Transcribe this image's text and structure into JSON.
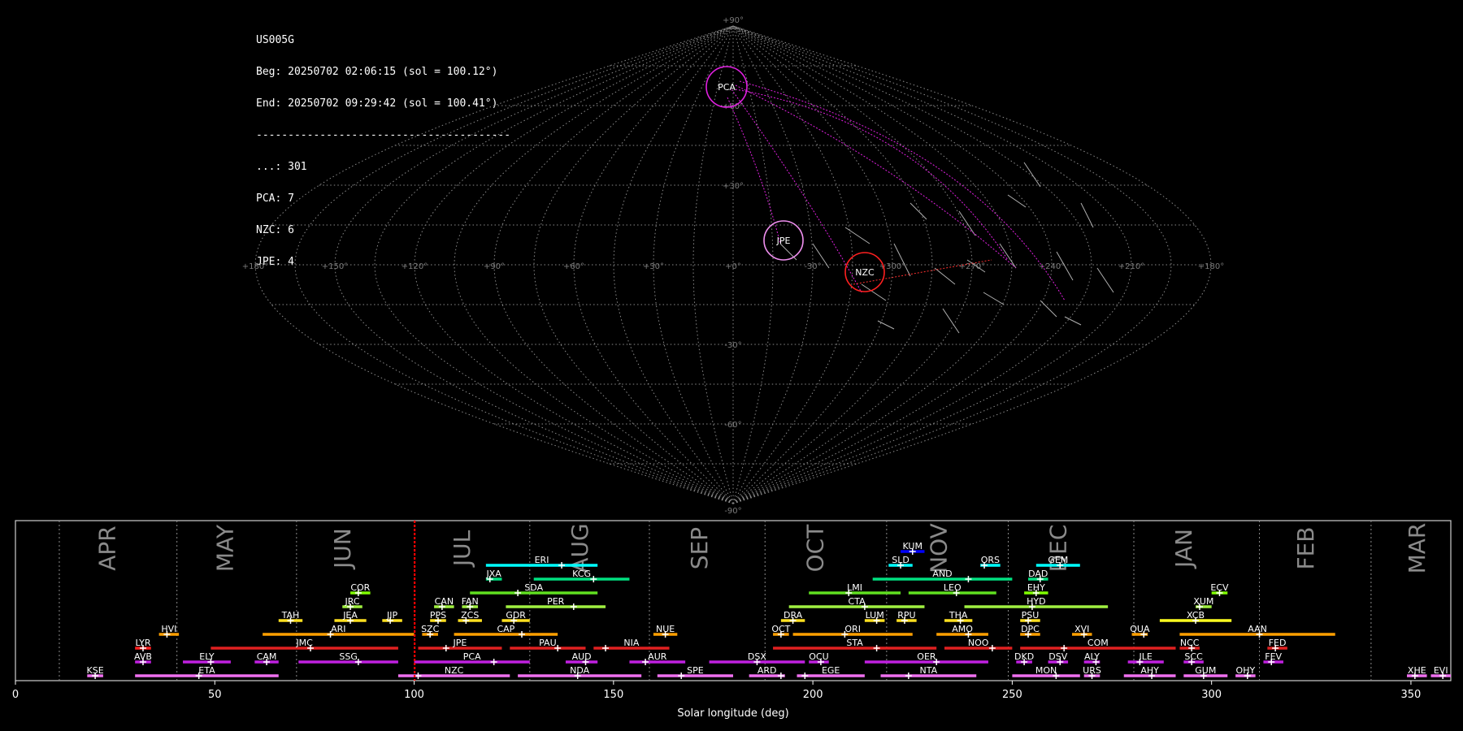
{
  "info": {
    "station": "US005G",
    "beg": "Beg: 20250702 02:06:15 (sol = 100.12°)",
    "end": "End: 20250702 09:29:42 (sol = 100.41°)",
    "sep": "----------------------------------------",
    "counts": [
      "...: 301",
      "PCA: 7",
      "NZC: 6",
      "JPE: 4"
    ]
  },
  "colors": {
    "PCA": "#e020e0",
    "JPE": "#f090f0",
    "NZC": "#ff2020",
    "marker": "#ff0000"
  },
  "chart_data": [
    {
      "type": "scatter",
      "projection": "sinusoidal all-sky map",
      "lon_ticks": [
        "+180°",
        "+150°",
        "+120°",
        "+90°",
        "+60°",
        "+30°",
        "+0°",
        "-30°",
        "+300°",
        "+270°",
        "+240°",
        "+210°",
        "+180°"
      ],
      "lat_ticks": [
        "+90°",
        "+60°",
        "+30°",
        "-30°",
        "-60°",
        "-90°"
      ],
      "circles": [
        {
          "name": "PCA",
          "label": "PCA",
          "color": "#e020e0"
        },
        {
          "name": "JPE",
          "label": "JPE",
          "color": "#f090f0"
        },
        {
          "name": "NZC",
          "label": "NZC",
          "color": "#ff2020"
        }
      ]
    },
    {
      "type": "timeline",
      "xlabel": "Solar longitude (deg)",
      "xlim": [
        0,
        360
      ],
      "xticks": [
        "0",
        "50",
        "100",
        "150",
        "200",
        "250",
        "300",
        "350"
      ],
      "xtick_values": [
        0,
        50,
        100,
        150,
        200,
        250,
        300,
        350
      ],
      "marker_sol": 100.12,
      "months": [
        {
          "label": "APR",
          "pos": 25
        },
        {
          "label": "MAY",
          "pos": 54.5
        },
        {
          "label": "JUN",
          "pos": 84
        },
        {
          "label": "JUL",
          "pos": 114
        },
        {
          "label": "AUG",
          "pos": 143.5
        },
        {
          "label": "SEP",
          "pos": 173.5
        },
        {
          "label": "OCT",
          "pos": 202.5
        },
        {
          "label": "NOV",
          "pos": 233.5
        },
        {
          "label": "DEC",
          "pos": 263.5
        },
        {
          "label": "JAN",
          "pos": 295
        },
        {
          "label": "FEB",
          "pos": 325.5
        },
        {
          "label": "MAR",
          "pos": 353.5
        }
      ],
      "month_bounds": [
        11,
        40.5,
        70.5,
        100,
        129,
        159,
        188,
        218.5,
        249,
        280.5,
        312,
        340
      ],
      "showers": [
        {
          "name": "KUM",
          "start": 222,
          "end": 228,
          "peak": 225,
          "row": 10,
          "color": "#0000ff"
        },
        {
          "name": "ERI",
          "start": 118,
          "end": 146,
          "peak": 137,
          "row": 9,
          "color": "#00ffff"
        },
        {
          "name": "SLD",
          "start": 219,
          "end": 225,
          "peak": 222,
          "row": 9,
          "color": "#00ffff"
        },
        {
          "name": "ORS",
          "start": 242,
          "end": 247,
          "peak": 243,
          "row": 9,
          "color": "#00ffff"
        },
        {
          "name": "GEM",
          "start": 256,
          "end": 267,
          "peak": 262,
          "row": 9,
          "color": "#00ffff"
        },
        {
          "name": "JXA",
          "start": 118,
          "end": 122,
          "peak": 119,
          "row": 8,
          "color": "#00e080"
        },
        {
          "name": "KCG",
          "start": 130,
          "end": 154,
          "peak": 145,
          "row": 8,
          "color": "#00e080"
        },
        {
          "name": "AND",
          "start": 215,
          "end": 250,
          "peak": 239,
          "row": 8,
          "color": "#00e080"
        },
        {
          "name": "DAD",
          "start": 254,
          "end": 259,
          "peak": 257,
          "row": 8,
          "color": "#00e080"
        },
        {
          "name": "COR",
          "start": 84,
          "end": 89,
          "peak": 86,
          "row": 7,
          "color": "#80ff00"
        },
        {
          "name": "SDA",
          "start": 114,
          "end": 146,
          "peak": 126,
          "row": 7,
          "color": "#60e020"
        },
        {
          "name": "LMI",
          "start": 199,
          "end": 222,
          "peak": 209,
          "row": 7,
          "color": "#60e020"
        },
        {
          "name": "LEO",
          "start": 224,
          "end": 246,
          "peak": 236,
          "row": 7,
          "color": "#60e020"
        },
        {
          "name": "EHY",
          "start": 253,
          "end": 259,
          "peak": 256,
          "row": 7,
          "color": "#80ff00"
        },
        {
          "name": "ECV",
          "start": 300,
          "end": 304,
          "peak": 302,
          "row": 7,
          "color": "#80ff00"
        },
        {
          "name": "JRC",
          "start": 82,
          "end": 87,
          "peak": 84,
          "row": 6,
          "color": "#a0f040"
        },
        {
          "name": "CAN",
          "start": 105,
          "end": 110,
          "peak": 107,
          "row": 6,
          "color": "#a0f040"
        },
        {
          "name": "FAN",
          "start": 112,
          "end": 116,
          "peak": 114,
          "row": 6,
          "color": "#a0f040"
        },
        {
          "name": "PER",
          "start": 123,
          "end": 148,
          "peak": 140,
          "row": 6,
          "color": "#a0f040"
        },
        {
          "name": "CTA",
          "start": 194,
          "end": 228,
          "peak": 213,
          "row": 6,
          "color": "#a0f040"
        },
        {
          "name": "HYD",
          "start": 238,
          "end": 274,
          "peak": 255,
          "row": 6,
          "color": "#a0f040"
        },
        {
          "name": "XUM",
          "start": 296,
          "end": 300,
          "peak": 297,
          "row": 6,
          "color": "#a0f040"
        },
        {
          "name": "TAH",
          "start": 66,
          "end": 72,
          "peak": 69,
          "row": 5,
          "color": "#ffe020"
        },
        {
          "name": "JEA",
          "start": 80,
          "end": 88,
          "peak": 84,
          "row": 5,
          "color": "#ffe020"
        },
        {
          "name": "JIP",
          "start": 92,
          "end": 97,
          "peak": 94,
          "row": 5,
          "color": "#ffe020"
        },
        {
          "name": "PPS",
          "start": 104,
          "end": 108,
          "peak": 106,
          "row": 5,
          "color": "#ffe020"
        },
        {
          "name": "ZCS",
          "start": 111,
          "end": 117,
          "peak": 113,
          "row": 5,
          "color": "#ffe020"
        },
        {
          "name": "GDR",
          "start": 122,
          "end": 129,
          "peak": 125,
          "row": 5,
          "color": "#ffe020"
        },
        {
          "name": "DRA",
          "start": 192,
          "end": 198,
          "peak": 195,
          "row": 5,
          "color": "#ffe020"
        },
        {
          "name": "LUM",
          "start": 213,
          "end": 218,
          "peak": 216,
          "row": 5,
          "color": "#ffe020"
        },
        {
          "name": "RPU",
          "start": 221,
          "end": 226,
          "peak": 223,
          "row": 5,
          "color": "#ffe020"
        },
        {
          "name": "THA",
          "start": 233,
          "end": 240,
          "peak": 237,
          "row": 5,
          "color": "#ffe020"
        },
        {
          "name": "PSU",
          "start": 252,
          "end": 257,
          "peak": 254,
          "row": 5,
          "color": "#ffe020"
        },
        {
          "name": "XCB",
          "start": 287,
          "end": 305,
          "peak": 296,
          "row": 5,
          "color": "#ffff20"
        },
        {
          "name": "HVI",
          "start": 36,
          "end": 41,
          "peak": 38,
          "row": 4,
          "color": "#ffa000"
        },
        {
          "name": "ARI",
          "start": 62,
          "end": 100,
          "peak": 79,
          "row": 4,
          "color": "#ffa000"
        },
        {
          "name": "SZC",
          "start": 102,
          "end": 106,
          "peak": 104,
          "row": 4,
          "color": "#ffa000"
        },
        {
          "name": "CAP",
          "start": 110,
          "end": 136,
          "peak": 127,
          "row": 4,
          "color": "#ffa000"
        },
        {
          "name": "NUE",
          "start": 160,
          "end": 166,
          "peak": 163,
          "row": 4,
          "color": "#ffa000"
        },
        {
          "name": "OCT",
          "start": 190,
          "end": 194,
          "peak": 192,
          "row": 4,
          "color": "#ffa000"
        },
        {
          "name": "ORI",
          "start": 195,
          "end": 225,
          "peak": 208,
          "row": 4,
          "color": "#ffa000"
        },
        {
          "name": "AMO",
          "start": 231,
          "end": 244,
          "peak": 239,
          "row": 4,
          "color": "#ffa000"
        },
        {
          "name": "DPC",
          "start": 252,
          "end": 257,
          "peak": 254,
          "row": 4,
          "color": "#ffa000"
        },
        {
          "name": "XVI",
          "start": 265,
          "end": 270,
          "peak": 268,
          "row": 4,
          "color": "#ffa000"
        },
        {
          "name": "QUA",
          "start": 280,
          "end": 284,
          "peak": 283,
          "row": 4,
          "color": "#ffa000"
        },
        {
          "name": "AAN",
          "start": 292,
          "end": 331,
          "peak": 312,
          "row": 4,
          "color": "#ffa000"
        },
        {
          "name": "LYR",
          "start": 30,
          "end": 34,
          "peak": 32,
          "row": 3,
          "color": "#ff2020"
        },
        {
          "name": "JMC",
          "start": 49,
          "end": 96,
          "peak": 74,
          "row": 3,
          "color": "#e02020"
        },
        {
          "name": "JPE",
          "start": 101,
          "end": 122,
          "peak": 108,
          "row": 3,
          "color": "#e02020"
        },
        {
          "name": "PAU",
          "start": 124,
          "end": 143,
          "peak": 136,
          "row": 3,
          "color": "#e02020"
        },
        {
          "name": "NIA",
          "start": 145,
          "end": 164,
          "peak": 148,
          "row": 3,
          "color": "#e02020"
        },
        {
          "name": "STA",
          "start": 190,
          "end": 231,
          "peak": 216,
          "row": 3,
          "color": "#e02020"
        },
        {
          "name": "NOO",
          "start": 233,
          "end": 250,
          "peak": 245,
          "row": 3,
          "color": "#e02020"
        },
        {
          "name": "COM",
          "start": 252,
          "end": 291,
          "peak": 263,
          "row": 3,
          "color": "#e02020"
        },
        {
          "name": "NCC",
          "start": 292,
          "end": 297,
          "peak": 295,
          "row": 3,
          "color": "#e02020"
        },
        {
          "name": "FED",
          "start": 314,
          "end": 319,
          "peak": 316,
          "row": 3,
          "color": "#e02020"
        },
        {
          "name": "AVB",
          "start": 30,
          "end": 34,
          "peak": 32,
          "row": 2,
          "color": "#c020e0"
        },
        {
          "name": "ELY",
          "start": 42,
          "end": 54,
          "peak": 49,
          "row": 2,
          "color": "#c020e0"
        },
        {
          "name": "CAM",
          "start": 60,
          "end": 66,
          "peak": 63,
          "row": 2,
          "color": "#c020e0"
        },
        {
          "name": "SSG",
          "start": 71,
          "end": 96,
          "peak": 86,
          "row": 2,
          "color": "#c020e0"
        },
        {
          "name": "PCA",
          "start": 100,
          "end": 129,
          "peak": 120,
          "row": 2,
          "color": "#c020e0"
        },
        {
          "name": "AUD",
          "start": 138,
          "end": 146,
          "peak": 143,
          "row": 2,
          "color": "#c020e0"
        },
        {
          "name": "AUR",
          "start": 154,
          "end": 168,
          "peak": 158,
          "row": 2,
          "color": "#c020e0"
        },
        {
          "name": "DSX",
          "start": 174,
          "end": 198,
          "peak": 186,
          "row": 2,
          "color": "#c020e0"
        },
        {
          "name": "OCU",
          "start": 199,
          "end": 204,
          "peak": 202,
          "row": 2,
          "color": "#c020e0"
        },
        {
          "name": "OER",
          "start": 213,
          "end": 244,
          "peak": 231,
          "row": 2,
          "color": "#c020e0"
        },
        {
          "name": "DKD",
          "start": 251,
          "end": 255,
          "peak": 253,
          "row": 2,
          "color": "#c020e0"
        },
        {
          "name": "DSV",
          "start": 259,
          "end": 264,
          "peak": 262,
          "row": 2,
          "color": "#c020e0"
        },
        {
          "name": "ALY",
          "start": 268,
          "end": 272,
          "peak": 271,
          "row": 2,
          "color": "#c020e0"
        },
        {
          "name": "ILE",
          "start": 279,
          "end": 288,
          "peak": 282,
          "row": 2,
          "color": "#c020e0"
        },
        {
          "name": "SCC",
          "start": 293,
          "end": 298,
          "peak": 295,
          "row": 2,
          "color": "#c020e0"
        },
        {
          "name": "FEV",
          "start": 313,
          "end": 318,
          "peak": 315,
          "row": 2,
          "color": "#c020e0"
        },
        {
          "name": "KSE",
          "start": 18,
          "end": 22,
          "peak": 20,
          "row": 1,
          "color": "#f070f0"
        },
        {
          "name": "ETA",
          "start": 30,
          "end": 66,
          "peak": 46,
          "row": 1,
          "color": "#f070f0"
        },
        {
          "name": "NZC",
          "start": 96,
          "end": 124,
          "peak": 101,
          "row": 1,
          "color": "#f070f0"
        },
        {
          "name": "NDA",
          "start": 126,
          "end": 157,
          "peak": 141,
          "row": 1,
          "color": "#f070f0"
        },
        {
          "name": "SPE",
          "start": 161,
          "end": 180,
          "peak": 167,
          "row": 1,
          "color": "#f070f0"
        },
        {
          "name": "ARD",
          "start": 184,
          "end": 193,
          "peak": 192,
          "row": 1,
          "color": "#f070f0"
        },
        {
          "name": "EGE",
          "start": 196,
          "end": 213,
          "peak": 198,
          "row": 1,
          "color": "#f070f0"
        },
        {
          "name": "NTA",
          "start": 217,
          "end": 241,
          "peak": 224,
          "row": 1,
          "color": "#f070f0"
        },
        {
          "name": "MON",
          "start": 250,
          "end": 267,
          "peak": 261,
          "row": 1,
          "color": "#f070f0"
        },
        {
          "name": "URS",
          "start": 268,
          "end": 272,
          "peak": 270,
          "row": 1,
          "color": "#f070f0"
        },
        {
          "name": "AHY",
          "start": 278,
          "end": 291,
          "peak": 285,
          "row": 1,
          "color": "#f070f0"
        },
        {
          "name": "GUM",
          "start": 293,
          "end": 304,
          "peak": 298,
          "row": 1,
          "color": "#f070f0"
        },
        {
          "name": "OHY",
          "start": 306,
          "end": 311,
          "peak": 309,
          "row": 1,
          "color": "#f070f0"
        },
        {
          "name": "XHE",
          "start": 349,
          "end": 354,
          "peak": 351,
          "row": 1,
          "color": "#f070f0"
        },
        {
          "name": "EVI",
          "start": 355,
          "end": 360,
          "peak": 358,
          "row": 1,
          "color": "#f070f0"
        }
      ]
    }
  ]
}
